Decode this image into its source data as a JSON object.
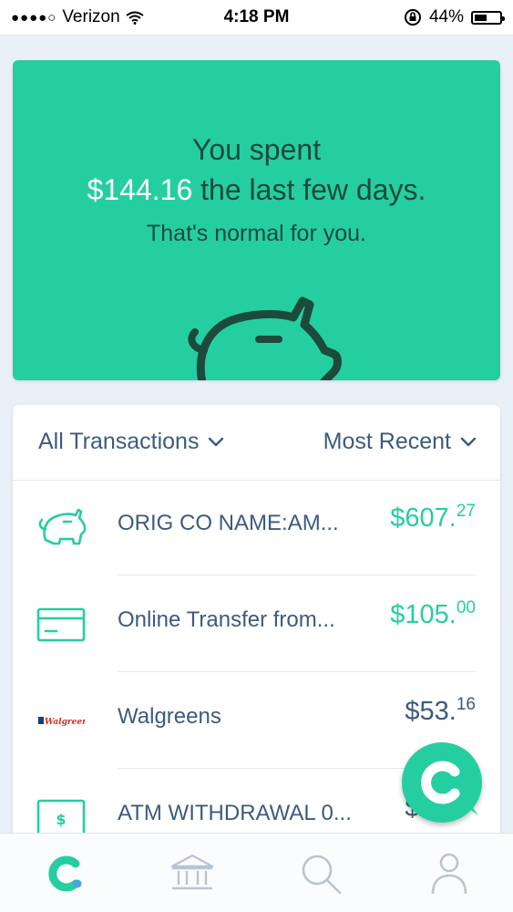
{
  "status_bar": {
    "carrier": "Verizon",
    "time": "4:18 PM",
    "battery": "44%",
    "battery_level": 0.44
  },
  "summary": {
    "line1": "You spent",
    "amount": "$144.16",
    "line2_rest": " the last few days.",
    "subtitle": "That's normal for you."
  },
  "filters": {
    "type": "All Transactions",
    "sort": "Most Recent"
  },
  "transactions": [
    {
      "name": "ORIG CO NAME:AM...",
      "amount_main": "$607.",
      "amount_cents": "27",
      "type": "credit",
      "icon": "piggy-bank-icon"
    },
    {
      "name": "Online Transfer from...",
      "amount_main": "$105.",
      "amount_cents": "00",
      "type": "credit",
      "icon": "card-icon"
    },
    {
      "name": "Walgreens",
      "amount_main": "$53.",
      "amount_cents": "16",
      "type": "debit",
      "icon": "walgreens-logo"
    },
    {
      "name": "ATM WITHDRAWAL 0...",
      "amount_main": "$60.",
      "amount_cents": "00",
      "type": "debit",
      "icon": "cash-icon"
    }
  ],
  "tabs": [
    "home-logo-icon",
    "bank-icon",
    "search-icon",
    "profile-icon"
  ],
  "colors": {
    "accent": "#25cea0",
    "text": "#3d5a80",
    "hero_text": "#1c4a3d",
    "background": "#eaf0f8"
  }
}
